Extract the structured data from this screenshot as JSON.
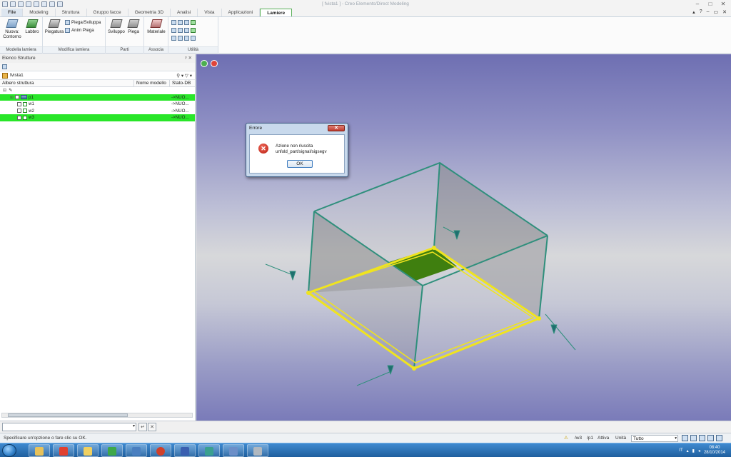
{
  "window": {
    "title": "[ fvista1 ] - Creo Elements/Direct Modeling"
  },
  "tabs": [
    "File",
    "Modeling",
    "Struttura",
    "Gruppo facce",
    "Geometria 3D",
    "Analisi",
    "Vista",
    "Applicazioni",
    "Lamiere"
  ],
  "active_tab": "Lamiere",
  "ribbon": {
    "buttons": {
      "nuova_contorno": "Nuova: Contorno",
      "labbro": "Labbro",
      "piegatura": "Piegatura",
      "piega_sviluppa": "Piega/Sviluppa",
      "anim_piega": "Anim Piega",
      "sviluppo": "Sviluppo",
      "piega": "Piega",
      "materiale": "Materiale"
    },
    "groups": [
      "Modella lamiera",
      "Modifica lamiera",
      "Parti",
      "Associa",
      "Utilità"
    ]
  },
  "left_panel": {
    "title": "Elenco Strutture",
    "search_value": "fvista1",
    "columns": [
      "Albero struttura",
      "Nome modello",
      "Stato-DB"
    ],
    "rows": [
      {
        "name": "p1",
        "state": "->NUO...",
        "highlight": true
      },
      {
        "name": "w1",
        "state": "->NUO...",
        "highlight": false
      },
      {
        "name": "w2",
        "state": "->NUO...",
        "highlight": false
      },
      {
        "name": "w3",
        "state": "->NUO...",
        "highlight": true
      }
    ]
  },
  "dialog": {
    "title": "Errore",
    "message_line1": "Azione non riuscita",
    "message_line2": "unfold_part/signal/sigsegv",
    "ok_label": "OK"
  },
  "status": {
    "prompt": "Specificare un'opzione o fare clic su OK.",
    "part": "/w3",
    "wp": "/p1",
    "state": "Attiva",
    "units": "Unità",
    "mode": "Tutto"
  },
  "taskbar": {
    "lang": "IT",
    "time": "08:40",
    "date": "28/10/2014"
  },
  "colors": {
    "highlight": "#29e629",
    "selection_edge": "#f0e41e",
    "wire": "#2f8f7c",
    "accent_tab": "#5ab05a"
  }
}
